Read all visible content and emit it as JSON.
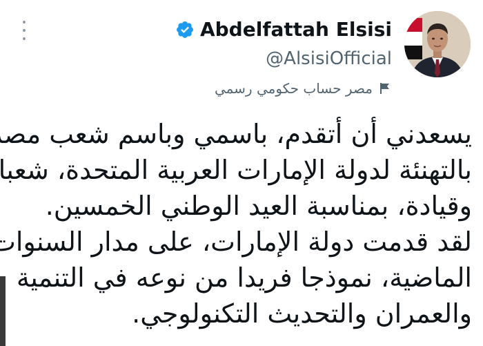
{
  "author": {
    "display_name": "Abdelfattah Elsisi",
    "handle": "@AlsisiOfficial",
    "verified_icon": "verified-badge-icon",
    "label": "مصر حساب حكومي رسمي",
    "label_icon": "flag-icon"
  },
  "tweet": {
    "lines": [
      "يسعدني أن أتقدم، باسمي وباسم شعب مصر،",
      "بالتهنئة لدولة الإمارات العربية المتحدة، شعبا",
      "وقيادة، بمناسبة العيد الوطني الخمسين.",
      "لقد قدمت دولة الإمارات، على مدار السنوات",
      "الماضية، نموذجا فريدا من نوعه في التنمية",
      "والعمران والتحديث التكنولوجي."
    ]
  },
  "colors": {
    "verified_blue": "#1d9bf0",
    "text_primary": "#0f1419",
    "text_secondary": "#536471"
  }
}
